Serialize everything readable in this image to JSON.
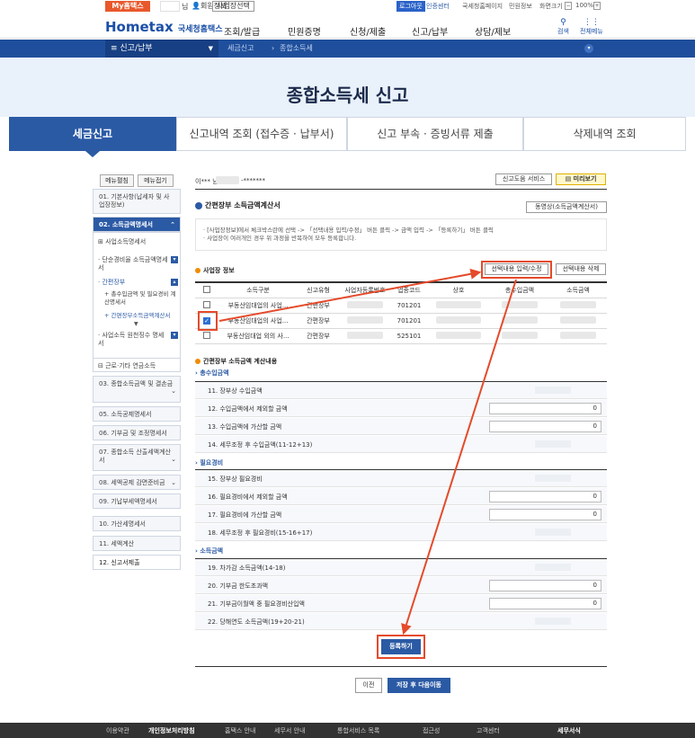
{
  "util": {
    "my": "My홈택스",
    "nim": "님",
    "myinfo": "회원정보",
    "biz_select": "사업장선택",
    "logout": "로그아웃",
    "cert": "인증센터",
    "links": [
      "국세청홈페이지",
      "민원정보",
      "화면크기",
      "100%"
    ]
  },
  "header": {
    "logo": "Hometax",
    "logo_sub": "국세청홈택스",
    "gnb": [
      "조회/발급",
      "민원증명",
      "신청/제출",
      "신고/납부",
      "상담/제보"
    ],
    "search": "검색",
    "all_menu": "전체메뉴"
  },
  "nav": {
    "menu": "신고/납부",
    "crumbs": [
      "세금신고",
      "종합소득세"
    ]
  },
  "banner": {
    "title": "종합소득세 신고"
  },
  "tabs": [
    "세금신고",
    "신고내역 조회 (접수증 · 납부서)",
    "신고 부속 · 증빙서류 제출",
    "삭제내역 조회"
  ],
  "leftmenu": {
    "expand": "메뉴펼침",
    "collapse": "메뉴접기",
    "items": [
      "01. 기본사항(납세자 및 사업장정보)",
      "02. 소득금액명세서",
      "03. 종합소득금액 및 결손금",
      "05. 소득공제명세서",
      "06. 기부금 및 조정명세서",
      "07. 종합소득 산출세액계산서",
      "08. 세액공제 감면준비금",
      "09. 기납부세액명세서",
      "10. 가산세명세서",
      "11. 세액계산",
      "12. 신고서제출"
    ],
    "sub": {
      "biz": "사업소득명세서",
      "simple": "단순경비율 소득금액명세서",
      "book": "간편장부",
      "book_sub1": "총수입금액 및 필요경비 계산명세서",
      "book_sub2": "간편장부소득금액계산서",
      "withhold": "사업소득 원천징수 명세서",
      "other": "근로·기타 연금소득"
    }
  },
  "main": {
    "user": "이*** 님 :",
    "user_no": "-*******",
    "help_service": "신고도움 서비스",
    "preview": "미리보기",
    "section1": "간편장부 소득금액계산서",
    "video_btn": "동영상(소득금액계산서)",
    "notes": [
      "· [사업장정보]에서 체크박스란에 선택 -> 「선택내용 입력/수정」 버튼 클릭 -> 금액 입력 -> 「등록하기」 버튼 클릭",
      "· 사업장이 여러개인 경우 위 과정을 반복하여 모두 등록합니다."
    ],
    "biz_info": "사업장 정보",
    "edit_btn": "선택내용 입력/수정",
    "delete_btn": "선택내용 삭제",
    "table": {
      "headers": [
        "소득구분",
        "신고유형",
        "사업자등록번호",
        "업종코드",
        "상호",
        "총수입금액",
        "소득금액"
      ],
      "rows": [
        {
          "checked": false,
          "type": "부동산임대업의 사업...",
          "kind": "간편장부",
          "code": "701201"
        },
        {
          "checked": true,
          "type": "부동산임대업의 사업...",
          "kind": "간편장부",
          "code": "701201"
        },
        {
          "checked": false,
          "type": "부동산임대업 외의 사...",
          "kind": "간편장부",
          "code": "525101"
        }
      ]
    },
    "section2": "간편장부 소득금액 계산내용",
    "cat1": "총수입금액",
    "cat2": "필요경비",
    "cat3": "소득금액",
    "rows": [
      {
        "label": "11. 장부상 수입금액",
        "input": null
      },
      {
        "label": "12. 수입금액에서 제외할 금액",
        "input": "0"
      },
      {
        "label": "13. 수입금액에 가산할 금액",
        "input": "0"
      },
      {
        "label": "14. 세무조정 후 수입금액(11-12+13)",
        "input": null
      },
      {
        "label": "15. 장부상 필요경비",
        "input": null
      },
      {
        "label": "16. 필요경비에서 제외할 금액",
        "input": "0"
      },
      {
        "label": "17. 필요경비에 가산할 금액",
        "input": "0"
      },
      {
        "label": "18. 세무조정 후 필요경비(15-16+17)",
        "input": null
      },
      {
        "label": "19. 차가감 소득금액(14-18)",
        "input": null
      },
      {
        "label": "20. 기부금 한도초과액",
        "input": "0"
      },
      {
        "label": "21. 기부금이월액 중 필요경비산입액",
        "input": "0"
      },
      {
        "label": "22. 당해연도 소득금액(19+20-21)",
        "input": null
      }
    ],
    "register": "등록하기",
    "prev": "이전",
    "save_next": "저장 후 다음이동"
  },
  "footer": {
    "links": [
      "이용약관",
      "개인정보처리방침",
      "홈택스 안내",
      "세무서 안내",
      "통합서비스 목록",
      "접근성",
      "고객센터",
      "세무서식"
    ]
  },
  "colors": {
    "primary": "#2b5aa5",
    "highlight": "#e54a2a",
    "brand_orange": "#e8582b"
  }
}
